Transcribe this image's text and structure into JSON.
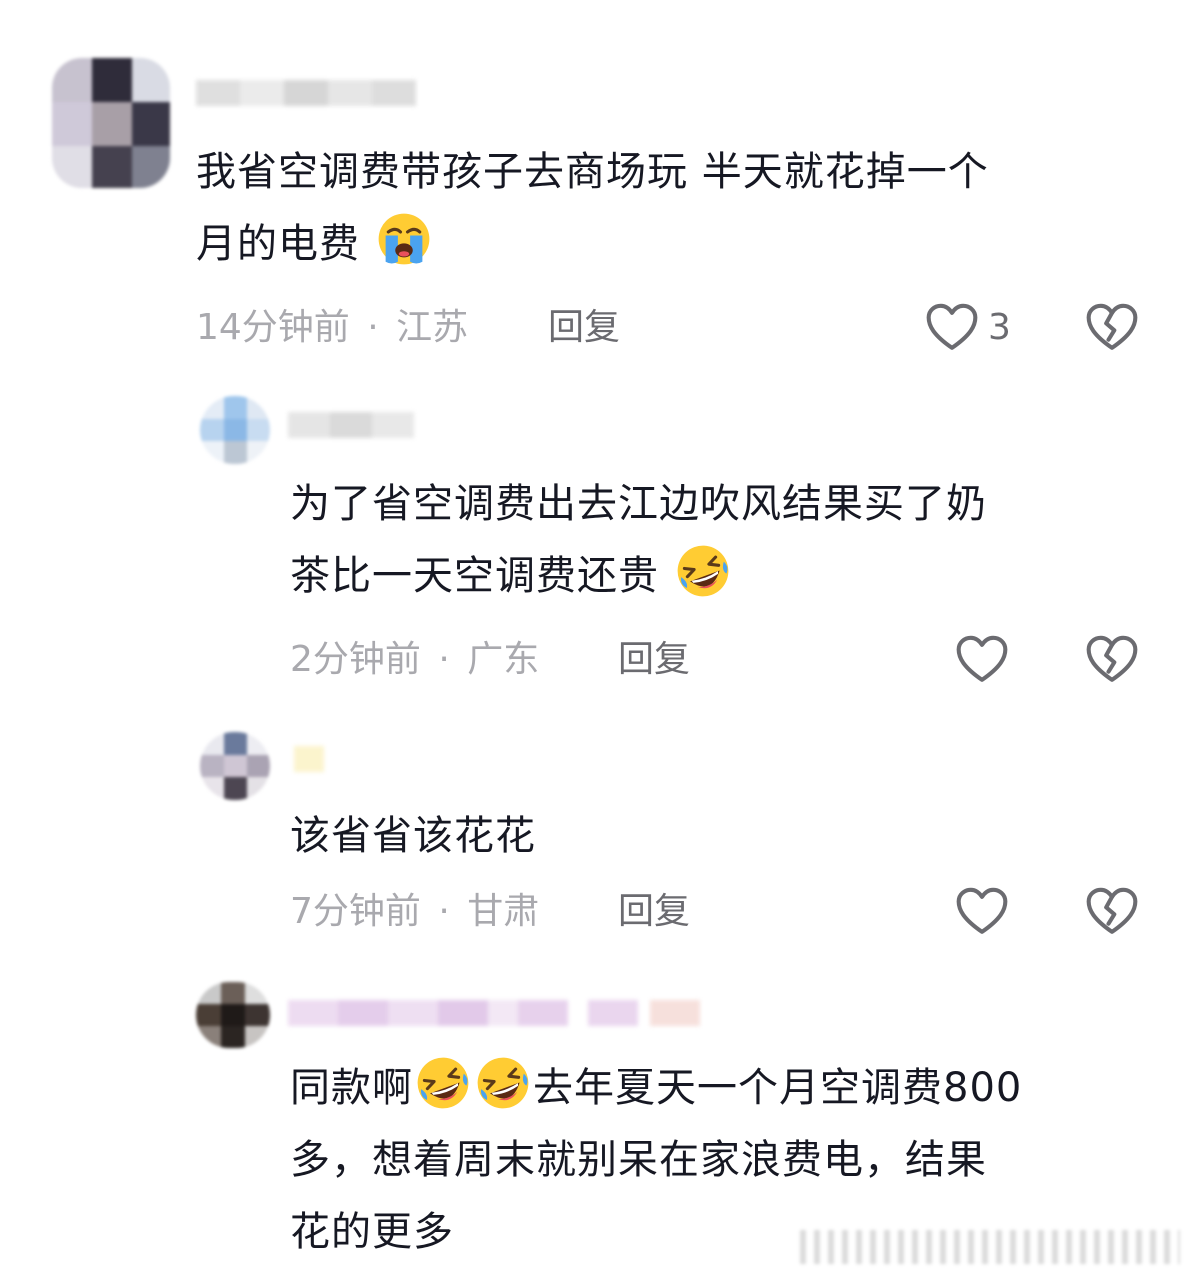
{
  "comments": [
    {
      "text_line1": "我省空调费带孩子去商场玩 半天就花掉一个",
      "text_line2": "月的电费",
      "emoji": "loudly-crying-face",
      "time": "14分钟前",
      "region": "江苏",
      "reply_label": "回复",
      "like_count": "3"
    },
    {
      "text_line1": "为了省空调费出去江边吹风结果买了奶",
      "text_line2": "茶比一天空调费还贵",
      "emoji": "rolling-on-floor-laughing",
      "time": "2分钟前",
      "region": "广东",
      "reply_label": "回复",
      "like_count": ""
    },
    {
      "text_line1": "该省省该花花",
      "time": "7分钟前",
      "region": "甘肃",
      "reply_label": "回复",
      "like_count": ""
    },
    {
      "text_prefix": "同款啊",
      "text_line1_suffix": "去年夏天一个月空调费800",
      "text_line2": "多，想着周末就别呆在家浪费电，结果",
      "text_line3": "花的更多",
      "emoji": "rolling-on-floor-laughing"
    }
  ],
  "separator": "·",
  "colors": {
    "text": "#161823",
    "meta": "#a9a9ae",
    "reply": "#6b6b70",
    "icon": "#6b6b70"
  }
}
